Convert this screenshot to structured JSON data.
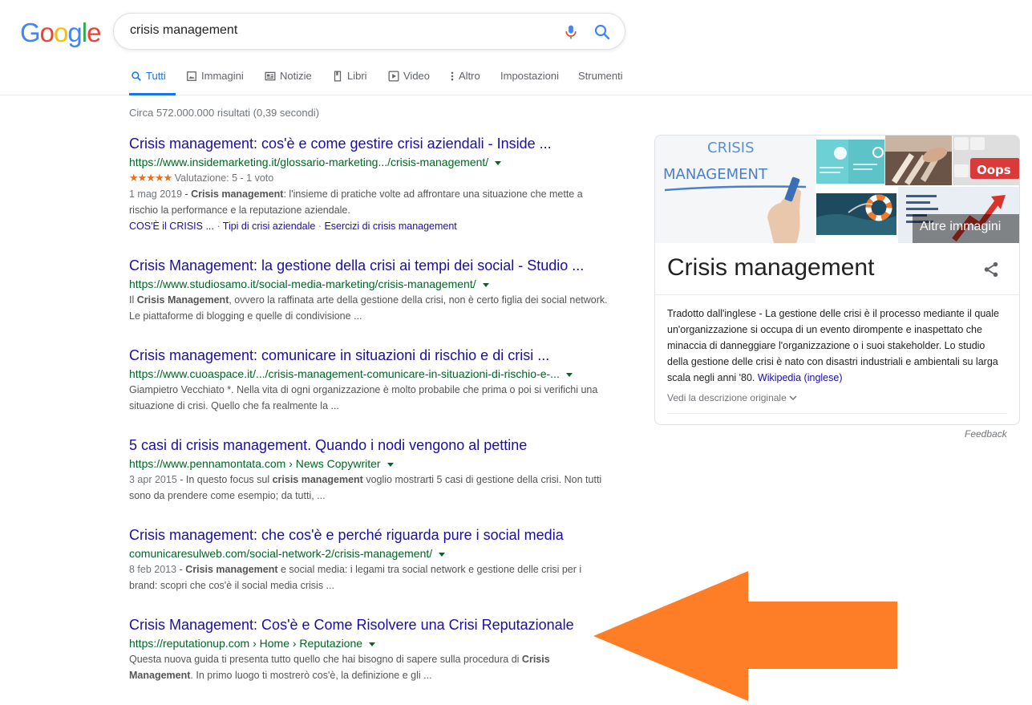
{
  "logo": {
    "letters": [
      "G",
      "o",
      "o",
      "g",
      "l",
      "e"
    ],
    "colors": [
      "#4285F4",
      "#EA4335",
      "#FBBC05",
      "#4285F4",
      "#34A853",
      "#EA4335"
    ]
  },
  "search": {
    "value": "crisis management"
  },
  "tabs": [
    {
      "label": "Tutti",
      "icon": "search-icon",
      "active": true
    },
    {
      "label": "Immagini",
      "icon": "image-icon"
    },
    {
      "label": "Notizie",
      "icon": "news-icon"
    },
    {
      "label": "Libri",
      "icon": "book-icon"
    },
    {
      "label": "Video",
      "icon": "play-icon"
    },
    {
      "label": "Altro",
      "icon": "more-vert-icon"
    },
    {
      "label": "Impostazioni"
    },
    {
      "label": "Strumenti"
    }
  ],
  "stats": "Circa 572.000.000 risultati (0,39 secondi)",
  "results": [
    {
      "title": "Crisis management: cos'è e come gestire crisi aziendali - Inside ...",
      "url": "https://www.insidemarketing.it/glossario-marketing.../crisis-management/",
      "rating": {
        "stars": "★★★★★",
        "text": "Valutazione: 5 - 1 voto",
        "value": 5
      },
      "date": "1 mag 2019",
      "snippet_bold": "Crisis management",
      "snippet_rest": ": l'insieme di pratiche volte ad affrontare una situazione che mette a rischio la performance e la reputazione aziendale.",
      "sitelinks": [
        "COS'È il CRISIS ...",
        "Tipi di crisi aziendale",
        "Esercizi di crisis management"
      ]
    },
    {
      "title": "Crisis Management: la gestione della crisi ai tempi dei social - Studio ...",
      "url": "https://www.studiosamo.it/social-media-marketing/crisis-management/",
      "pre": "Il ",
      "snippet_bold": "Crisis Management",
      "snippet_rest": ", ovvero la raffinata arte della gestione della crisi, non è certo figlia dei social network. Le piattaforme di blogging e quelle di condivisione ..."
    },
    {
      "title": "Crisis management: comunicare in situazioni di rischio e di crisi ...",
      "url": "https://www.cuoaspace.it/.../crisis-management-comunicare-in-situazioni-di-rischio-e-...",
      "snippet_rest": "Giampietro Vecchiato *. Nella vita di ogni organizzazione è molto probabile che prima o poi si verifichi una situazione di crisi. Quello che fa realmente la ..."
    },
    {
      "title": "5 casi di crisis management. Quando i nodi vengono al pettine",
      "url": "https://www.pennamontata.com › News Copywriter",
      "date": "3 apr 2015",
      "pre": "In questo focus sul ",
      "snippet_bold": "crisis management",
      "snippet_rest": " voglio mostrarti 5 casi di gestione della crisi. Non tutti sono da prendere come esempio; da tutti, ..."
    },
    {
      "title": "Crisis management: che cos'è e perché riguarda pure i social media",
      "url": "comunicaresulweb.com/social-network-2/crisis-management/",
      "date": "8 feb 2013",
      "snippet_bold": "Crisis management",
      "snippet_rest": " e social media: i legami tra social network e gestione delle crisi per i brand: scopri che cos'è il social media crisis ..."
    },
    {
      "title": "Crisis Management: Cos'è e Come Risolvere una Crisi Reputazionale",
      "url": "https://reputationup.com › Home › Reputazione",
      "pre": "Questa nuova guida ti presenta tutto quello che hai bisogno di sapere sulla procedura di ",
      "snippet_bold": "Crisis Management",
      "snippet_rest": ". In primo luogo ti mostrerò cos'è, la definizione e gli ..."
    }
  ],
  "knowledge_panel": {
    "main_image_text": [
      "CRISIS",
      "MANAGEMENT"
    ],
    "more_images": "Altre immagini",
    "oops": "Oops",
    "title": "Crisis management",
    "description": "Tradotto dall'inglese - La gestione delle crisi è il processo mediante il quale un'organizzazione si occupa di un evento dirompente e inaspettato che minaccia di danneggiare l'organizzazione o i suoi stakeholder. Lo studio della gestione delle crisi è nato con disastri industriali e ambientali su larga scala negli anni '80.",
    "wikipedia": "Wikipedia (inglese)",
    "show_original": "Vedi la descrizione originale",
    "feedback": "Feedback"
  },
  "colors": {
    "link": "#1a0dab",
    "url": "#006621",
    "accent": "#1a73e8",
    "arrow": "#fd7e26"
  }
}
